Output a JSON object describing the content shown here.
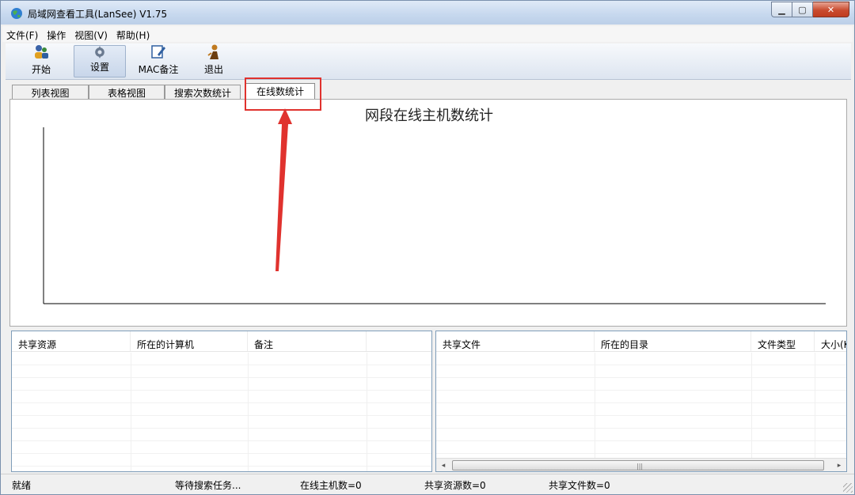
{
  "window": {
    "title": "局域网查看工具(LanSee) V1.75"
  },
  "menu": {
    "items": [
      "文件(F)",
      "操作",
      "视图(V)",
      "帮助(H)"
    ]
  },
  "toolbar": {
    "start": "开始",
    "settings": "设置",
    "mac_note": "MAC备注",
    "exit": "退出"
  },
  "tabs": {
    "list_view": "列表视图",
    "table_view": "表格视图",
    "search_stats": "搜索次数统计",
    "online_stats": "在线数统计"
  },
  "chart_data": {
    "type": "bar",
    "title": "网段在线主机数统计",
    "categories": [],
    "values": [],
    "xlabel": "",
    "ylabel": "",
    "grid": false
  },
  "shares_list": {
    "columns": [
      "共享资源",
      "所在的计算机",
      "备注"
    ]
  },
  "files_list": {
    "columns": [
      "共享文件",
      "所在的目录",
      "文件类型",
      "大小(K"
    ]
  },
  "status": {
    "state": "就绪",
    "task": "等待搜索任务...",
    "online_hosts": "在线主机数=0",
    "shared_resources": "共享资源数=0",
    "shared_files": "共享文件数=0"
  },
  "colors": {
    "annotation": "#e0322e",
    "titlebar": "#c6d8ee"
  }
}
